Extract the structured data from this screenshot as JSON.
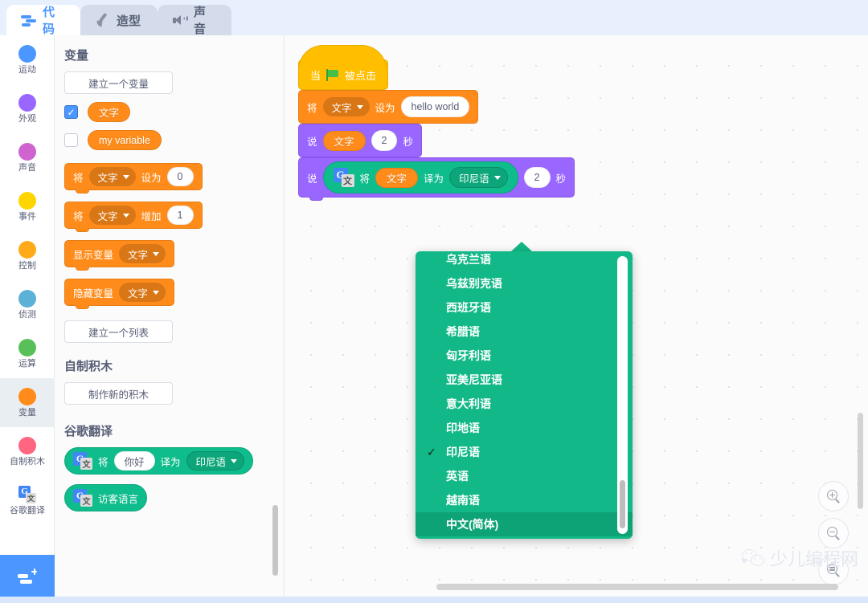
{
  "tabs": [
    {
      "label": "代码",
      "icon": "code-icon",
      "active": true
    },
    {
      "label": "造型",
      "icon": "brush-icon",
      "active": false
    },
    {
      "label": "声音",
      "icon": "speaker-icon",
      "active": false
    }
  ],
  "categories": [
    {
      "label": "运动",
      "color": "#4c97ff",
      "selected": false
    },
    {
      "label": "外观",
      "color": "#9966ff",
      "selected": false
    },
    {
      "label": "声音",
      "color": "#cf63cf",
      "selected": false
    },
    {
      "label": "事件",
      "color": "#ffd500",
      "selected": false
    },
    {
      "label": "控制",
      "color": "#ffab19",
      "selected": false
    },
    {
      "label": "侦测",
      "color": "#5cb1d6",
      "selected": false
    },
    {
      "label": "运算",
      "color": "#59c059",
      "selected": false
    },
    {
      "label": "变量",
      "color": "#ff8c1a",
      "selected": true
    },
    {
      "label": "自制积木",
      "color": "#ff6680",
      "selected": false
    },
    {
      "label": "谷歌翻译",
      "color": "#0fbd8c",
      "selected": false,
      "icon": "google-translate-icon"
    }
  ],
  "palette": {
    "section_variables": "变量",
    "make_variable_button": "建立一个变量",
    "variables": [
      {
        "name": "文字",
        "checked": true
      },
      {
        "name": "my variable",
        "checked": false
      }
    ],
    "blocks": {
      "set_prefix": "将",
      "set_var": "文字",
      "set_mid": "设为",
      "set_value": "0",
      "change_prefix": "将",
      "change_var": "文字",
      "change_mid": "增加",
      "change_value": "1",
      "show_label": "显示变量",
      "show_var": "文字",
      "hide_label": "隐藏变量",
      "hide_var": "文字"
    },
    "make_list_button": "建立一个列表",
    "section_my_blocks": "自制积木",
    "make_block_button": "制作新的积木",
    "section_translate": "谷歌翻译",
    "translate_block": {
      "prefix": "将",
      "text": "你好",
      "mid": "译为",
      "language": "印尼语"
    },
    "viewer_language_block": "访客语言"
  },
  "script": {
    "hat": {
      "prefix": "当",
      "suffix": "被点击",
      "icon": "green-flag-icon"
    },
    "set_block": {
      "prefix": "将",
      "variable": "文字",
      "mid": "设为",
      "value": "hello world"
    },
    "say_block": {
      "prefix": "说",
      "variable": "文字",
      "seconds": "2",
      "unit": "秒"
    },
    "say_translate_block": {
      "prefix": "说",
      "tr_prefix": "将",
      "tr_variable": "文字",
      "tr_mid": "译为",
      "tr_language": "印尼语",
      "seconds": "2",
      "unit": "秒"
    }
  },
  "language_menu": {
    "items": [
      {
        "label": "乌克兰语",
        "checked": false,
        "highlighted": false,
        "clipped": true
      },
      {
        "label": "乌兹别克语",
        "checked": false,
        "highlighted": false
      },
      {
        "label": "西班牙语",
        "checked": false,
        "highlighted": false
      },
      {
        "label": "希腊语",
        "checked": false,
        "highlighted": false
      },
      {
        "label": "匈牙利语",
        "checked": false,
        "highlighted": false
      },
      {
        "label": "亚美尼亚语",
        "checked": false,
        "highlighted": false
      },
      {
        "label": "意大利语",
        "checked": false,
        "highlighted": false
      },
      {
        "label": "印地语",
        "checked": false,
        "highlighted": false
      },
      {
        "label": "印尼语",
        "checked": true,
        "highlighted": false
      },
      {
        "label": "英语",
        "checked": false,
        "highlighted": false
      },
      {
        "label": "越南语",
        "checked": false,
        "highlighted": false
      },
      {
        "label": "中文(简体)",
        "checked": false,
        "highlighted": true
      }
    ],
    "check_mark": "✓"
  },
  "zoom_controls": [
    {
      "name": "zoom-in",
      "glyph": "+"
    },
    {
      "name": "zoom-out",
      "glyph": "−"
    },
    {
      "name": "zoom-reset",
      "glyph": "="
    }
  ],
  "watermark": {
    "text": "少儿编程网",
    "icon": "wechat-icon"
  },
  "extension_button": {
    "icon": "add-extension-icon"
  },
  "colors": {
    "accent_blue": "#4c97ff",
    "variables_orange": "#ff8c1a",
    "looks_purple": "#9966ff",
    "events_yellow": "#ffbf00",
    "translate_green": "#0fbd8c",
    "menu_green": "#12b887",
    "menu_highlight": "#0ea377"
  }
}
